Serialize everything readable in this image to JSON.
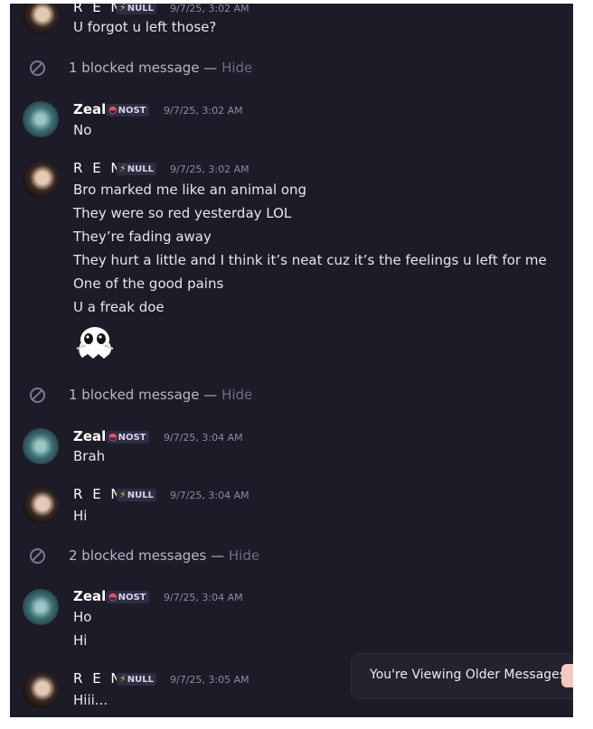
{
  "colors": {
    "background": "#1c1b27",
    "text": "#e6e6ee",
    "muted": "#8e8aa3",
    "tag_bg": "#2f2d43",
    "null_bolt": "#f0c23c",
    "nost_icon": "#ff4d62"
  },
  "tags": {
    "null": "NULL",
    "nost": "NOST"
  },
  "icons": {
    "null": "lightning-bolt-icon",
    "nost": "nost-badge-icon",
    "blocked": "blocked-icon"
  },
  "names": {
    "ren": "R E N",
    "zeal": "Zeal"
  },
  "messages": [
    {
      "author": "R E N",
      "time": "9/7/25, 3:02 AM",
      "lines": [
        "U forgot u left those?"
      ]
    },
    {
      "author": "Zeal",
      "time": "9/7/25, 3:02 AM",
      "lines": [
        "No"
      ]
    },
    {
      "author": "R E N",
      "time": "9/7/25, 3:02 AM",
      "lines": [
        "Bro marked me like an animal ong",
        "They were so red yesterday LOL",
        "They’re fading away",
        "They hurt a little and I think it’s neat cuz it’s the feelings u left for me",
        "One of the good pains",
        "U a freak doe"
      ],
      "sticker": "ghost-sticker"
    },
    {
      "author": "Zeal",
      "time": "9/7/25, 3:04 AM",
      "lines": [
        "Brah"
      ]
    },
    {
      "author": "R E N",
      "time": "9/7/25, 3:04 AM",
      "lines": [
        "Hi"
      ]
    },
    {
      "author": "Zeal",
      "time": "9/7/25, 3:04 AM",
      "lines": [
        "Ho",
        "Hi"
      ]
    },
    {
      "author": "R E N",
      "time": "9/7/25, 3:05 AM",
      "lines": [
        "Hiii..."
      ]
    }
  ],
  "blocked": [
    {
      "text": "1 blocked message",
      "action": "Hide"
    },
    {
      "text": "1 blocked message",
      "action": "Hide"
    },
    {
      "text": "2 blocked messages",
      "action": "Hide"
    }
  ],
  "dash": "—",
  "older_banner": {
    "label": "You're Viewing Older Messages"
  }
}
